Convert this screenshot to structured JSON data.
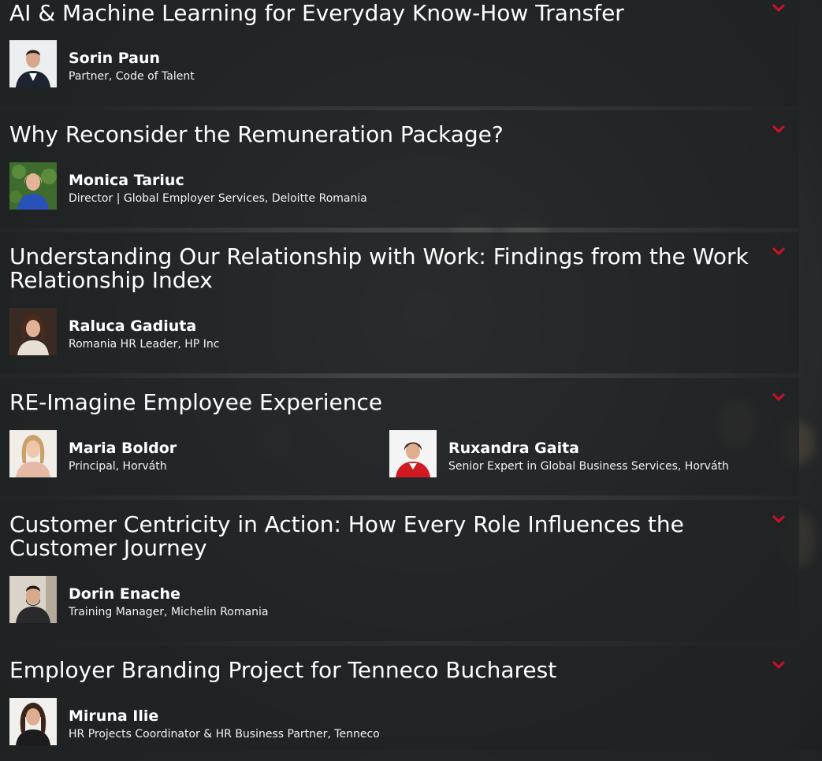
{
  "sessions": [
    {
      "title": "AI & Machine Learning for Everyday Know-How Transfer",
      "speakers": [
        {
          "name": "Sorin Paun",
          "role": "Partner, Code of Talent"
        }
      ]
    },
    {
      "title": "Why Reconsider the Remuneration Package?",
      "speakers": [
        {
          "name": "Monica Tariuc",
          "role": "Director | Global Employer Services, Deloitte Romania"
        }
      ]
    },
    {
      "title": "Understanding Our Relationship with Work: Findings from the Work Relationship Index",
      "speakers": [
        {
          "name": "Raluca Gadiuta",
          "role": "Romania HR Leader, HP Inc"
        }
      ]
    },
    {
      "title": "RE-Imagine Employee Experience",
      "speakers": [
        {
          "name": "Maria Boldor",
          "role": "Principal, Horváth"
        },
        {
          "name": "Ruxandra Gaita",
          "role": "Senior Expert in Global Business Services, Horváth"
        }
      ]
    },
    {
      "title": "Customer Centricity in Action: How Every Role Influences the Customer Journey",
      "speakers": [
        {
          "name": "Dorin Enache",
          "role": "Training Manager, Michelin Romania"
        }
      ]
    },
    {
      "title": "Employer Branding Project for Tenneco Bucharest",
      "speakers": [
        {
          "name": "Miruna Ilie",
          "role": "HR Projects Coordinator & HR Business Partner, Tenneco"
        }
      ]
    }
  ],
  "icons": {
    "expand": "chevron-down-icon",
    "photo": "speaker-photo"
  },
  "colors": {
    "accent": "#d0102a",
    "text": "#ffffff",
    "panel": "#202224"
  }
}
